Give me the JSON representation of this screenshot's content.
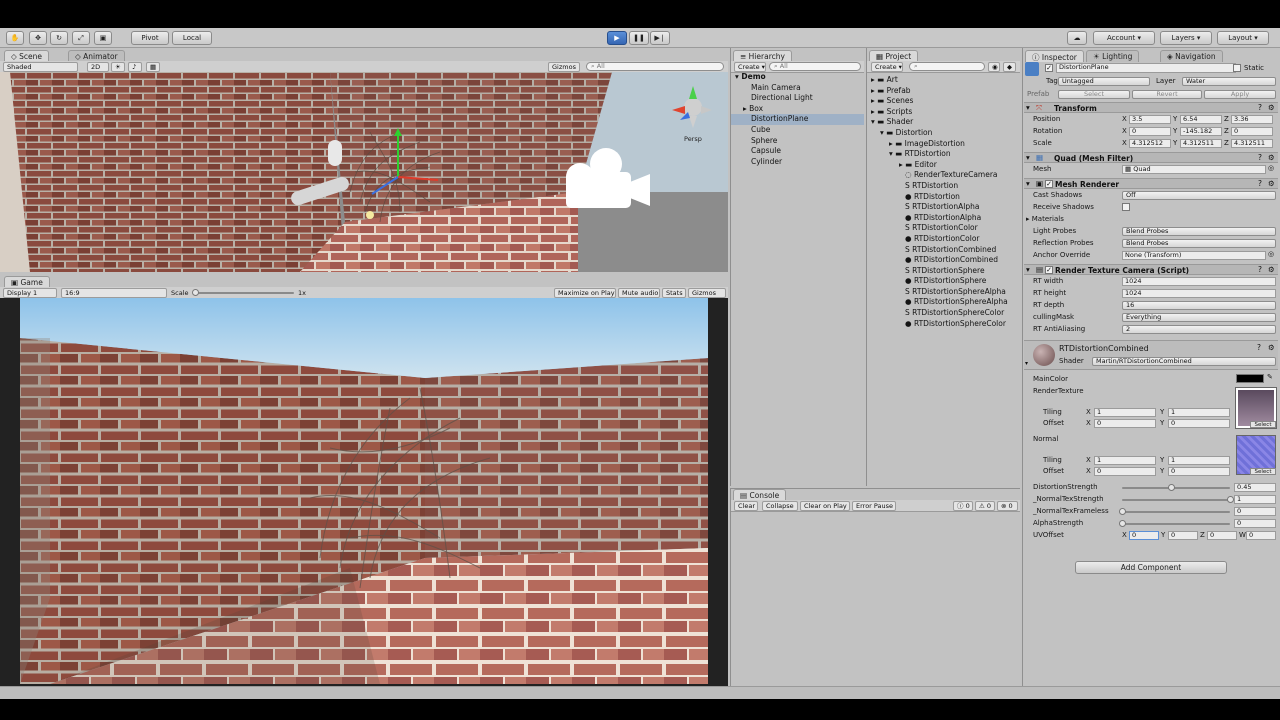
{
  "toolbar": {
    "pivot": "Pivot",
    "local": "Local",
    "account": "Account",
    "layers": "Layers",
    "layout": "Layout"
  },
  "scene": {
    "tab_scene": "Scene",
    "tab_animator": "Animator",
    "shading": "Shaded",
    "mode_2d": "2D",
    "gizmos": "Gizmos",
    "search_placeholder": "All",
    "persp": "Persp"
  },
  "game": {
    "tab": "Game",
    "display": "Display 1",
    "aspect": "16:9",
    "scale_label": "Scale",
    "scale_value": "1x",
    "maximize": "Maximize on Play",
    "mute": "Mute audio",
    "stats": "Stats",
    "gizmos": "Gizmos"
  },
  "hierarchy": {
    "tab": "Hierarchy",
    "create": "Create",
    "search_placeholder": "All",
    "root": "Demo",
    "items": [
      "Main Camera",
      "Directional Light",
      "Box",
      "DistortionPlane",
      "Cube",
      "Sphere",
      "Capsule",
      "Cylinder"
    ]
  },
  "project": {
    "tab": "Project",
    "create": "Create",
    "items": [
      "Art",
      "Prefab",
      "Scenes",
      "Scripts",
      "Shader",
      "Distortion",
      "ImageDistortion",
      "RTDistortion",
      "Editor",
      "RenderTextureCamera",
      "RTDistortion",
      "RTDistortion",
      "RTDistortionAlpha",
      "RTDistortionAlpha",
      "RTDistortionColor",
      "RTDistortionColor",
      "RTDistortionCombined",
      "RTDistortionCombined",
      "RTDistortionSphere",
      "RTDistortionSphere",
      "RTDistortionSphereAlpha",
      "RTDistortionSphereAlpha",
      "RTDistortionSphereColor",
      "RTDistortionSphereColor"
    ]
  },
  "console": {
    "tab": "Console",
    "clear": "Clear",
    "collapse": "Collapse",
    "clear_on_play": "Clear on Play",
    "error_pause": "Error Pause",
    "count_info": "0",
    "count_warn": "0",
    "count_error": "0"
  },
  "inspector": {
    "tab_inspector": "Inspector",
    "tab_lighting": "Lighting",
    "tab_navigation": "Navigation",
    "object_name": "DistortionPlane",
    "static": "Static",
    "tag_label": "Tag",
    "tag": "Untagged",
    "layer_label": "Layer",
    "layer": "Water",
    "prefab": "Prefab",
    "select": "Select",
    "revert": "Revert",
    "apply": "Apply",
    "transform": {
      "title": "Transform",
      "position_label": "Position",
      "rotation_label": "Rotation",
      "scale_label": "Scale",
      "position": [
        "3.5",
        "6.54",
        "3.36"
      ],
      "rotation": [
        "0",
        "-145.182",
        "0"
      ],
      "scale": [
        "4.312512",
        "4.312511",
        "4.312511"
      ]
    },
    "mesh_filter": {
      "title": "Quad (Mesh Filter)",
      "mesh_label": "Mesh",
      "mesh": "Quad"
    },
    "mesh_renderer": {
      "title": "Mesh Renderer",
      "cast_shadows_label": "Cast Shadows",
      "cast_shadows": "Off",
      "receive_shadows_label": "Receive Shadows",
      "materials_label": "Materials",
      "light_probes_label": "Light Probes",
      "light_probes": "Blend Probes",
      "reflection_probes_label": "Reflection Probes",
      "reflection_probes": "Blend Probes",
      "anchor_override_label": "Anchor Override",
      "anchor_override": "None (Transform)"
    },
    "rt_camera": {
      "title": "Render Texture Camera (Script)",
      "rt_width_label": "RT width",
      "rt_width": "1024",
      "rt_height_label": "RT height",
      "rt_height": "1024",
      "rt_depth_label": "RT depth",
      "rt_depth": "16",
      "culling_mask_label": "cullingMask",
      "culling_mask": "Everything",
      "rt_aa_label": "RT AntiAliasing",
      "rt_aa": "2"
    },
    "material": {
      "name": "RTDistortionCombined",
      "shader_label": "Shader",
      "shader": "Martin/RTDistortionCombined",
      "main_color_label": "MainColor",
      "render_texture_label": "RenderTexture",
      "tiling_label": "Tiling",
      "offset_label": "Offset",
      "normal_label": "Normal",
      "rt_tiling": [
        "1",
        "1"
      ],
      "rt_offset": [
        "0",
        "0"
      ],
      "normal_tiling": [
        "1",
        "1"
      ],
      "normal_offset": [
        "0",
        "0"
      ],
      "select": "Select",
      "distortion_strength_label": "DistortionStrength",
      "distortion_strength": 0.45,
      "normal_tex_strength_label": "_NormalTexStrength",
      "normal_tex_strength": 1,
      "normal_tex_frameless_label": "_NormalTexFrameless",
      "normal_tex_frameless": 0,
      "alpha_strength_label": "AlphaStrength",
      "alpha_strength": 0,
      "uv_offset_label": "UVOffset",
      "uv_offset": [
        "0",
        "0",
        "0",
        "0"
      ]
    },
    "add_component": "Add Component"
  },
  "colors": {
    "play_button": "#3a6fc0",
    "selection": "#9fb1c6",
    "panel_bg": "#c2c2c2",
    "sky": "#9fcbe8"
  }
}
